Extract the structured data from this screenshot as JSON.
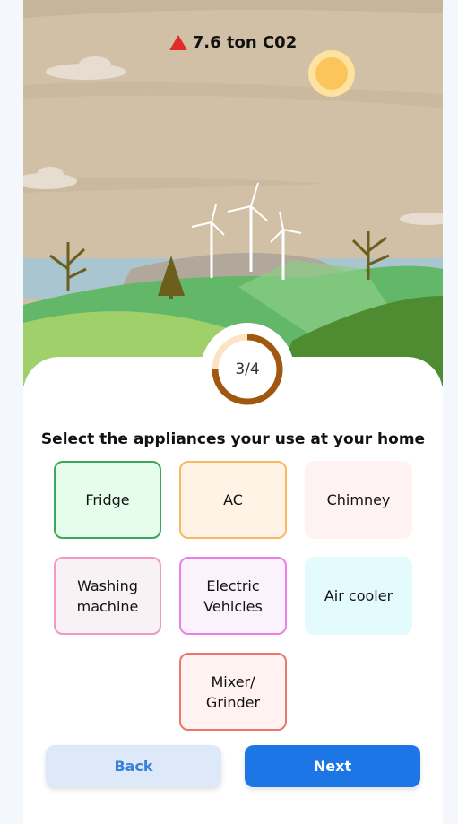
{
  "header": {
    "emission": "7.6 ton C02",
    "icon": "warning-triangle-icon",
    "icon_color": "#e02b2b"
  },
  "progress": {
    "current": 3,
    "total": 4,
    "label": "3/4",
    "color": "#a0570f",
    "track": "#fde3c4"
  },
  "question": "Select the appliances your use at your home",
  "options": [
    {
      "label": "Fridge",
      "selected": true,
      "border": "#3fa65a",
      "bg": "#e5fdea"
    },
    {
      "label": "AC",
      "selected": true,
      "border": "#fbb662",
      "bg": "#fff3e5"
    },
    {
      "label": "Chimney",
      "selected": false,
      "border": "transparent",
      "bg": "#fff2f2"
    },
    {
      "label": "Washing machine",
      "selected": true,
      "border": "#ef9ac4",
      "bg": "#f8f2f4"
    },
    {
      "label": "Electric Vehicles",
      "selected": true,
      "border": "#ea7fe9",
      "bg": "#fcf2fd"
    },
    {
      "label": "Air cooler",
      "selected": false,
      "border": "transparent",
      "bg": "#e3fbfd"
    },
    {
      "label": "Mixer/ Grinder",
      "selected": true,
      "border": "#e8776c",
      "bg": "#fff2f1"
    }
  ],
  "buttons": {
    "back": "Back",
    "next": "Next"
  }
}
